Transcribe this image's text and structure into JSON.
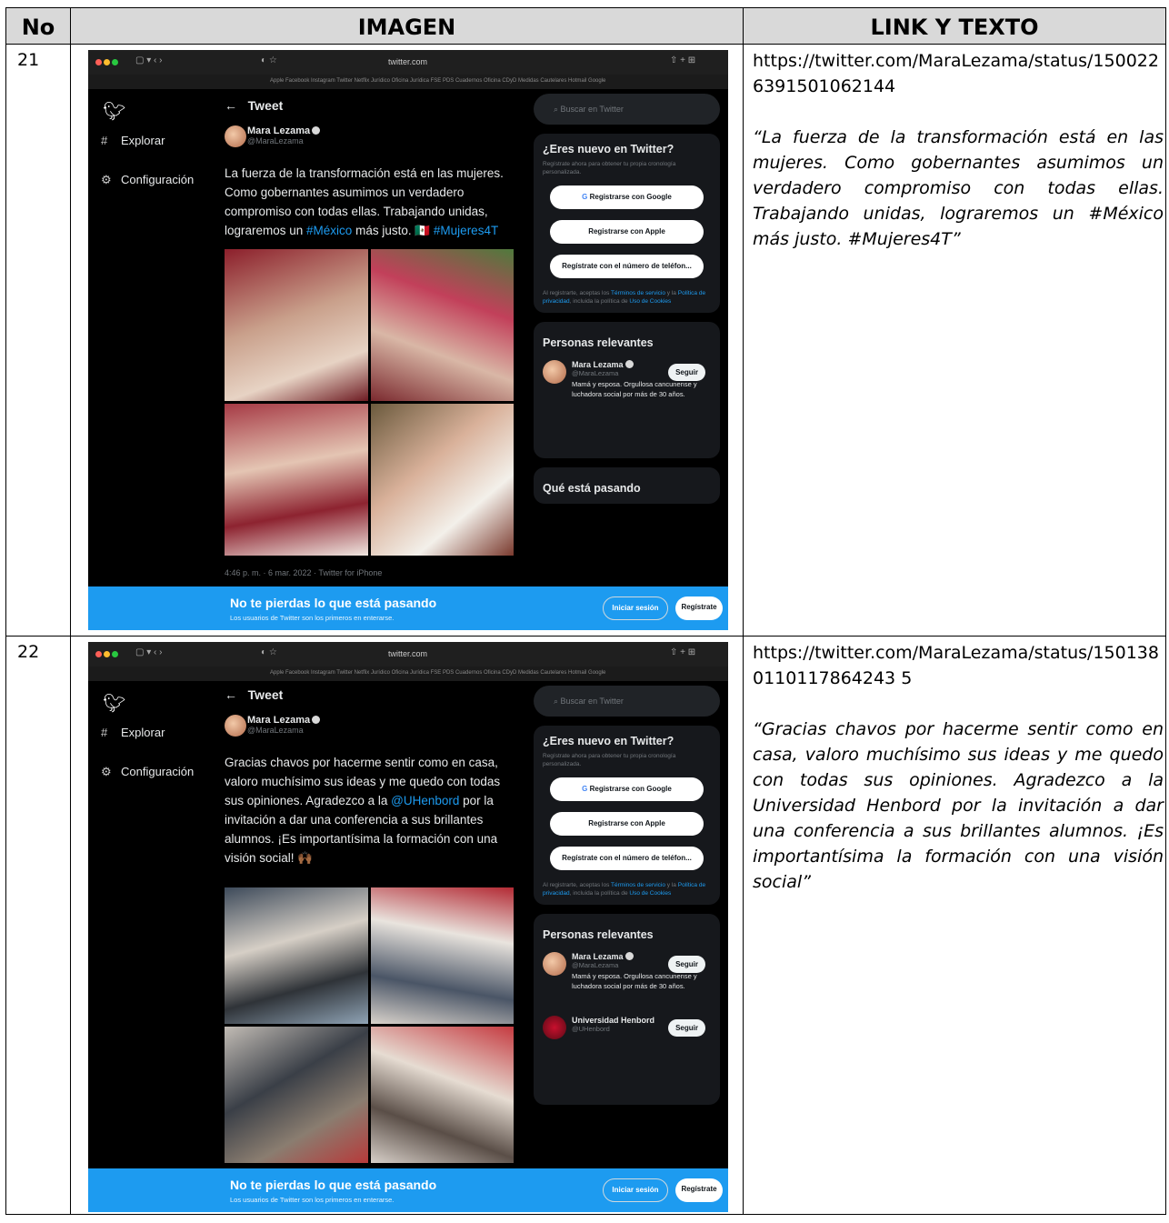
{
  "table": {
    "headers": [
      "No",
      "IMAGEN",
      "LINK Y TEXTO"
    ],
    "rows": [
      {
        "no": "21",
        "link": "https://twitter.com/MaraLezama/status/1500226391501062144",
        "quote": "“La fuerza de la transformación está en las mujeres. Como gobernantes asumimos un verdadero compromiso con todas ellas. Trabajando unidas, lograremos un #México más justo. #Mujeres4T”",
        "shot": {
          "body_pre": "La fuerza de la transformación está en las mujeres. Como gobernantes asumimos un verdadero compromiso con todas ellas. Trabajando unidas, lograremos un ",
          "hashtag1": "#México",
          "body_mid": " más justo. ",
          "hashtag2": "#Mujeres4T",
          "timestamp": "4:46 p. m. · 6 mar. 2022 · Twitter for iPhone",
          "trending_title": "Qué está pasando"
        }
      },
      {
        "no": "22",
        "link": "https://twitter.com/MaraLezama/status/1501380110117864243 5",
        "quote": "“Gracias chavos por hacerme sentir como en casa, valoro muchísimo sus ideas y me quedo con todas sus opiniones. Agradezco a la Universidad Henbord por la invitación a dar una conferencia a sus brillantes alumnos. ¡Es importantísima la formación con una visión social”",
        "shot": {
          "body_pre": "Gracias chavos por hacerme sentir como en casa, valoro muchísimo sus ideas y me quedo con todas sus opiniones. Agradezco a la ",
          "mention": "@UHenbord",
          "body_post": " por la invitación a dar una conferencia a sus brillantes alumnos. ¡Es importantísima la formación con una visión social! 🙌🏾",
          "person2_name": "Universidad Henbord",
          "person2_handle": "@UHenbord"
        }
      }
    ]
  },
  "twitter": {
    "url": "twitter.com",
    "bookmarks": "Apple  Facebook  Instagram  Twitter  Netflix  Jurídico  Oficina Jurídica  FSE  PDS  Cuadernos  Oficina CDyD  Medidas Cautelares  Hotmail  Google",
    "explore": "Explorar",
    "settings": "Configuración",
    "header": "Tweet",
    "author_name": "Mara Lezama",
    "author_handle": "@MaraLezama",
    "search_placeholder": "Buscar en Twitter",
    "new_title": "¿Eres nuevo en Twitter?",
    "new_sub": "Regístrate ahora para obtener tu propia cronología personalizada.",
    "btn_google": "Registrarse con Google",
    "btn_apple": "Registrarse con Apple",
    "btn_phone": "Regístrate con el número de teléfon...",
    "terms_pre": "Al registrarte, aceptas los ",
    "terms_link1": "Términos de servicio",
    "terms_mid": " y la ",
    "terms_link2": "Política de privacidad",
    "terms_post": ", incluida la política de ",
    "terms_link3": "Uso de Cookies",
    "relevant_title": "Personas relevantes",
    "bio": "Mamá y esposa. Orgullosa cancunense y luchadora social por más de 30 años.",
    "follow": "Seguir",
    "banner_title": "No te pierdas lo que está pasando",
    "banner_sub": "Los usuarios de Twitter son los primeros en enterarse.",
    "login": "Iniciar sesión",
    "register": "Regístrate"
  },
  "colors": {
    "twitter_blue": "#1d9bf0",
    "header_gray": "#d9d9d9"
  }
}
